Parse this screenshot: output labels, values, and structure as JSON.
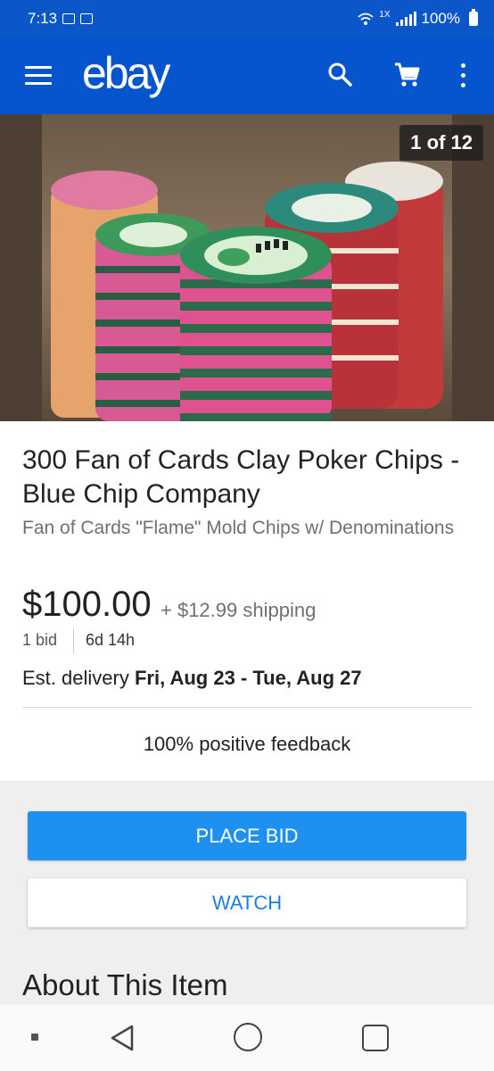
{
  "status_bar": {
    "time": "7:13",
    "network_label": "1X",
    "battery": "100%"
  },
  "app_bar": {
    "logo": "ebay"
  },
  "image": {
    "counter": "1 of 12"
  },
  "listing": {
    "title": "300 Fan of Cards Clay Poker Chips - Blue Chip Company",
    "subtitle": "Fan of Cards \"Flame\" Mold Chips w/ Denominations",
    "price": "$100.00",
    "shipping": "+ $12.99 shipping",
    "bids": "1 bid",
    "time_left": "6d 14h",
    "delivery_label": "Est. delivery",
    "delivery_dates": "Fri, Aug 23 - Tue, Aug 27",
    "feedback": "100% positive feedback"
  },
  "actions": {
    "place_bid": "PLACE BID",
    "watch": "WATCH"
  },
  "section": {
    "about": "About This Item"
  },
  "colors": {
    "app_bar": "#0654ce",
    "bid_button": "#1e90f0",
    "watch_text": "#1b7fe0"
  }
}
